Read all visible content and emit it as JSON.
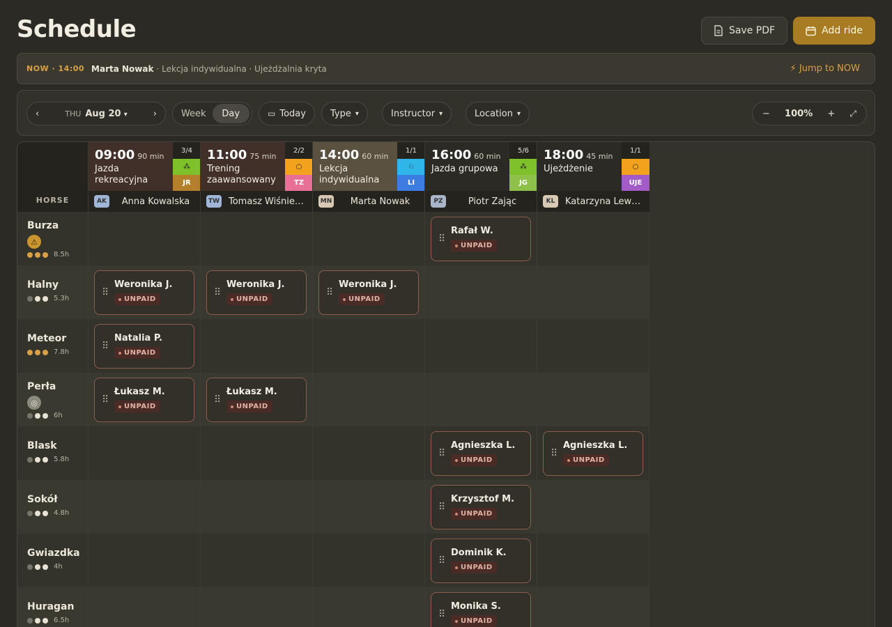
{
  "header": {
    "title": "Schedule",
    "save_pdf": "Save PDF",
    "add_ride": "Add ride"
  },
  "now": {
    "label": "NOW · 14:00",
    "name": "Marta Nowak",
    "info": "· Lekcja indywidualna · Ujeżdżalnia kryta",
    "jump": "Jump to NOW"
  },
  "toolbar": {
    "dow": "THU",
    "date": "Aug 20",
    "view_week": "Week",
    "view_day": "Day",
    "active_view": "Day",
    "today": "Today",
    "type": "Type",
    "instructor": "Instructor",
    "location": "Location",
    "zoom": "100%"
  },
  "grid": {
    "horse_header": "HORSE"
  },
  "sessions": [
    {
      "time": "09:00",
      "duration": "90 min",
      "name": "Jazda rekreacyjna",
      "count": "3/4",
      "type_color": "#7ec12a",
      "type_icon": "people-icon",
      "initials": "JR",
      "initials_color": "#b5802b",
      "instructor_initials": "AK",
      "instructor": "Anna Kowalska",
      "avatar_color": "#9fb6d6",
      "bg": "#41302a"
    },
    {
      "time": "11:00",
      "duration": "75 min",
      "name": "Trening zaawansowany",
      "count": "2/2",
      "type_color": "#f2a21c",
      "type_icon": "circle-icon",
      "initials": "TZ",
      "initials_color": "#e86f96",
      "instructor_initials": "TW",
      "instructor": "Tomasz Wiśniew...",
      "avatar_color": "#9fb6d6",
      "bg": "#41302a"
    },
    {
      "time": "14:00",
      "duration": "60 min",
      "name": "Lekcja indywidualna",
      "count": "1/1",
      "type_color": "#2fb5e8",
      "type_icon": "person-icon",
      "initials": "LI",
      "initials_color": "#3b7de0",
      "instructor_initials": "MN",
      "instructor": "Marta Nowak",
      "avatar_color": "#d8c9b5",
      "bg": "#5a5140"
    },
    {
      "time": "16:00",
      "duration": "60 min",
      "name": "Jazda grupowa",
      "count": "5/6",
      "type_color": "#7ec12a",
      "type_icon": "people-icon",
      "initials": "JG",
      "initials_color": "#8fc14a",
      "instructor_initials": "PZ",
      "instructor": "Piotr Zając",
      "avatar_color": "#a9b6c9",
      "bg": "#2b2a24"
    },
    {
      "time": "18:00",
      "duration": "45 min",
      "name": "Ujeżdżenie",
      "count": "1/1",
      "type_color": "#f2a21c",
      "type_icon": "circle-icon",
      "initials": "UJE",
      "initials_color": "#a35cc7",
      "instructor_initials": "KL",
      "instructor": "Katarzyna Lewa...",
      "avatar_color": "#d8c9b5",
      "bg": "#2b2a24"
    }
  ],
  "horses": [
    {
      "name": "Burza",
      "hours": "8.5h",
      "level": 3,
      "icon": "warning-icon",
      "icon_glyph": "⚠",
      "cards": [
        {
          "col": 3,
          "rider": "Rafał W.",
          "status": "UNPAID"
        }
      ]
    },
    {
      "name": "Halny",
      "hours": "5.3h",
      "level": 1,
      "cards": [
        {
          "col": 0,
          "rider": "Weronika J.",
          "status": "UNPAID"
        },
        {
          "col": 1,
          "rider": "Weronika J.",
          "status": "UNPAID"
        },
        {
          "col": 2,
          "rider": "Weronika J.",
          "status": "UNPAID"
        }
      ]
    },
    {
      "name": "Meteor",
      "hours": "7.8h",
      "level": 3,
      "cards": [
        {
          "col": 0,
          "rider": "Natalia P.",
          "status": "UNPAID"
        }
      ]
    },
    {
      "name": "Perła",
      "hours": "6h",
      "level": 1,
      "icon": "horseshoe-icon",
      "icon_glyph": "◎",
      "cards": [
        {
          "col": 0,
          "rider": "Łukasz M.",
          "status": "UNPAID"
        },
        {
          "col": 1,
          "rider": "Łukasz M.",
          "status": "UNPAID"
        }
      ]
    },
    {
      "name": "Blask",
      "hours": "5.8h",
      "level": 1,
      "cards": [
        {
          "col": 3,
          "rider": "Agnieszka L.",
          "status": "UNPAID"
        },
        {
          "col": 4,
          "rider": "Agnieszka L.",
          "status": "UNPAID"
        }
      ]
    },
    {
      "name": "Sokół",
      "hours": "4.8h",
      "level": 1,
      "cards": [
        {
          "col": 3,
          "rider": "Krzysztof M.",
          "status": "UNPAID"
        }
      ]
    },
    {
      "name": "Gwiazdka",
      "hours": "4h",
      "level": 1,
      "cards": [
        {
          "col": 3,
          "rider": "Dominik K.",
          "status": "UNPAID"
        }
      ]
    },
    {
      "name": "Huragan",
      "hours": "6.5h",
      "level": 1,
      "cards": [
        {
          "col": 3,
          "rider": "Monika S.",
          "status": "UNPAID"
        }
      ]
    }
  ],
  "colors": {
    "accent": "#a87c22",
    "now_accent": "#d9a04a",
    "unpaid_bg": "#4b2b26",
    "card_border": "#8a5e50"
  }
}
